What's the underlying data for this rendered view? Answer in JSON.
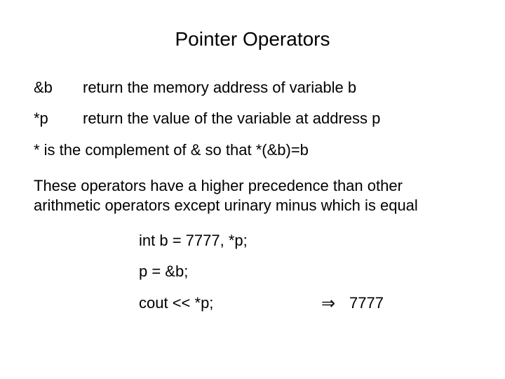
{
  "title": "Pointer Operators",
  "defs": [
    {
      "op": "&b",
      "desc": "return the memory address of variable b"
    },
    {
      "op": "*p",
      "desc": "return the value of the variable at address p"
    }
  ],
  "complement_line": "* is the complement of & so that *(&b)=b",
  "precedence_line": "These operators have a higher precedence than other arithmetic operators except urinary minus which is equal",
  "code": {
    "line1": "int b = 7777, *p;",
    "line2": "p = &b;",
    "line3": "cout << *p;",
    "arrow": "⇒",
    "result": "7777"
  }
}
